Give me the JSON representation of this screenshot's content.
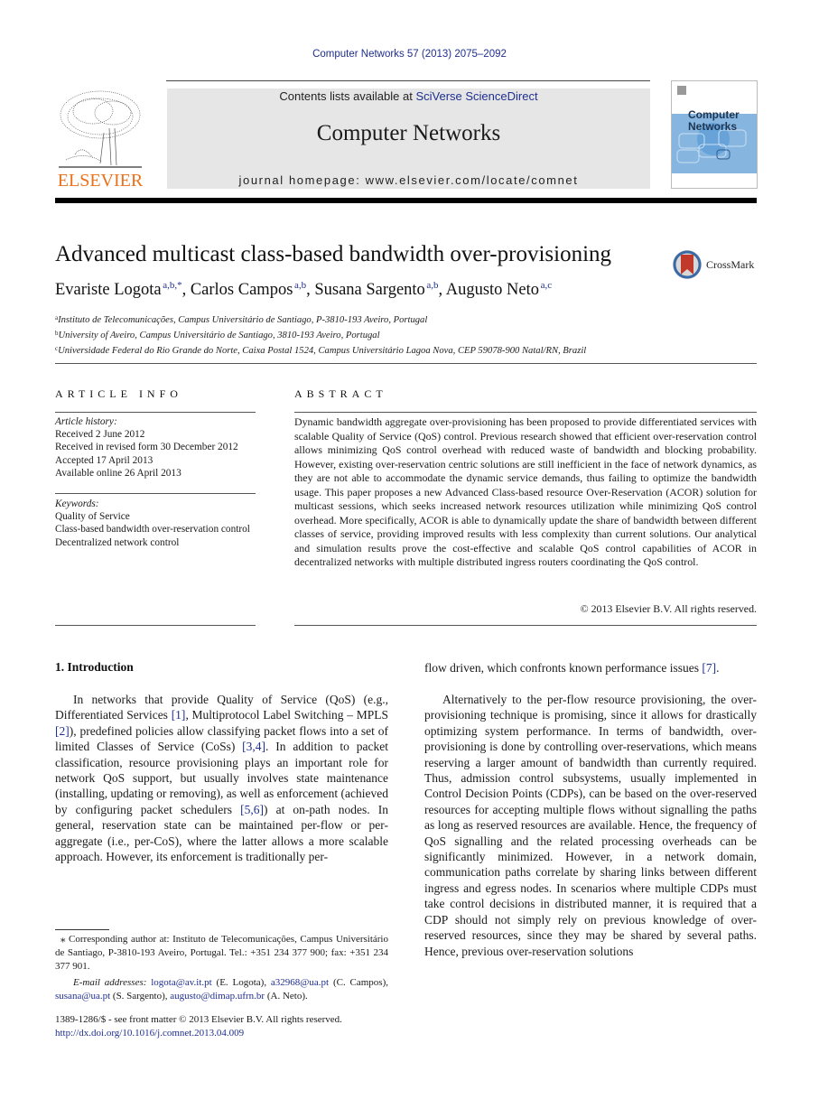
{
  "running_head": "Computer Networks 57 (2013) 2075–2092",
  "masthead": {
    "contents_prefix": "Contents lists available at ",
    "contents_link": "SciVerse ScienceDirect",
    "journal_name": "Computer Networks",
    "homepage": "journal homepage: www.elsevier.com/locate/comnet"
  },
  "publisher_logo": {
    "wordmark": "ELSEVIER",
    "color": "#e9711c",
    "icon": "elsevier-tree-icon"
  },
  "cover": {
    "line1": "Computer",
    "line2": "Networks",
    "band_color": "#86b6e0"
  },
  "crossmark": {
    "label": "CrossMark",
    "icon": "crossmark-icon"
  },
  "article": {
    "title": "Advanced multicast class-based bandwidth over-provisioning",
    "authors": [
      {
        "name": "Evariste Logota",
        "sup": "a,b,*",
        "sep": ", "
      },
      {
        "name": "Carlos Campos",
        "sup": "a,b",
        "sep": ", "
      },
      {
        "name": "Susana Sargento",
        "sup": "a,b",
        "sep": ", "
      },
      {
        "name": "Augusto Neto",
        "sup": "a,c",
        "sep": ""
      }
    ],
    "affiliations": [
      {
        "mark": "a",
        "text": "Instituto de Telecomunicações, Campus Universitário de Santiago, P-3810-193 Aveiro, Portugal"
      },
      {
        "mark": "b",
        "text": "University of Aveiro, Campus Universitário de Santiago, 3810-193 Aveiro, Portugal"
      },
      {
        "mark": "c",
        "text": "Universidade Federal do Rio Grande do Norte, Caixa Postal 1524, Campus Universitário Lagoa Nova, CEP 59078-900 Natal/RN, Brazil"
      }
    ]
  },
  "article_info": {
    "heading": "ARTICLE INFO",
    "history_label": "Article history:",
    "history": [
      "Received 2 June 2012",
      "Received in revised form 30 December 2012",
      "Accepted 17 April 2013",
      "Available online 26 April 2013"
    ],
    "keywords_label": "Keywords:",
    "keywords": [
      "Quality of Service",
      "Class-based bandwidth over-reservation control",
      "Decentralized network control"
    ]
  },
  "abstract": {
    "heading": "ABSTRACT",
    "text": "Dynamic bandwidth aggregate over-provisioning has been proposed to provide differentiated services with scalable Quality of Service (QoS) control. Previous research showed that efficient over-reservation control allows minimizing QoS control overhead with reduced waste of bandwidth and blocking probability. However, existing over-reservation centric solutions are still inefficient in the face of network dynamics, as they are not able to accommodate the dynamic service demands, thus failing to optimize the bandwidth usage. This paper proposes a new Advanced Class-based resource Over-Reservation (ACOR) solution for multicast sessions, which seeks increased network resources utilization while minimizing QoS control overhead. More specifically, ACOR is able to dynamically update the share of bandwidth between different classes of service, providing improved results with less complexity than current solutions. Our analytical and simulation results prove the cost-effective and scalable QoS control capabilities of ACOR in decentralized networks with multiple distributed ingress routers coordinating the QoS control.",
    "copyright": "© 2013 Elsevier B.V. All rights reserved."
  },
  "introduction": {
    "heading": "1. Introduction",
    "p1": [
      {
        "t": "In networks that provide Quality of Service (QoS) (e.g., Differentiated Services "
      },
      {
        "ref": "[1]"
      },
      {
        "t": ", Multiprotocol Label Switching – MPLS "
      },
      {
        "ref": "[2]"
      },
      {
        "t": "), predefined policies allow classifying packet flows into a set of limited Classes of Service (CoSs) "
      },
      {
        "ref": "[3,4]"
      },
      {
        "t": ". In addition to packet classification, resource provisioning plays an important role for network QoS support, but usually involves state maintenance (installing, updating or removing), as well as enforcement (achieved by configuring packet schedulers "
      },
      {
        "ref": "[5,6]"
      },
      {
        "t": ") at on-path nodes. In general, reservation state can be maintained per-flow or per-aggregate (i.e., per-CoS), where the latter allows a more scalable approach. However, its enforcement is traditionally per-"
      }
    ],
    "p1_cont": [
      {
        "t": "flow driven, which confronts known performance issues "
      },
      {
        "ref": "[7]"
      },
      {
        "t": "."
      }
    ],
    "p2": "Alternatively to the per-flow resource provisioning, the over-provisioning technique is promising, since it allows for drastically optimizing system performance. In terms of bandwidth, over-provisioning is done by controlling over-reservations, which means reserving a larger amount of bandwidth than currently required. Thus, admission control subsystems, usually implemented in Control Decision Points (CDPs), can be based on the over-reserved resources for accepting multiple flows without signalling the paths as long as reserved resources are available. Hence, the frequency of QoS signalling and the related processing overheads can be significantly minimized. However, in a network domain, communication paths correlate by sharing links between different ingress and egress nodes. In scenarios where multiple CDPs must take control decisions in distributed manner, it is required that a CDP should not simply rely on previous knowledge of over-reserved resources, since they may be shared by several paths. Hence, previous over-reservation solutions"
  },
  "footnotes": {
    "corresponding_mark": "⁎",
    "corresponding": " Corresponding author at: Instituto de Telecomunicações, Campus Universitário de Santiago, P-3810-193 Aveiro, Portugal. Tel.: +351 234 377 900; fax: +351 234 377 901.",
    "email_label": "E-mail addresses:",
    "emails": [
      {
        "address": "logota@av.it.pt",
        "owner": " (E. Logota), "
      },
      {
        "address": "a32968@ua.pt",
        "owner": " (C. Campos), "
      },
      {
        "address": "susana@ua.pt",
        "owner": " (S. Sargento), "
      },
      {
        "address": "augusto@dimap.ufrn.br",
        "owner": " (A. Neto)."
      }
    ],
    "front_matter": "1389-1286/$ - see front matter © 2013 Elsevier B.V. All rights reserved.",
    "doi": "http://dx.doi.org/10.1016/j.comnet.2013.04.009"
  },
  "colors": {
    "link": "#1f2f8f",
    "masthead_bg": "#e6e6e6",
    "elsevier_orange": "#e9711c"
  }
}
